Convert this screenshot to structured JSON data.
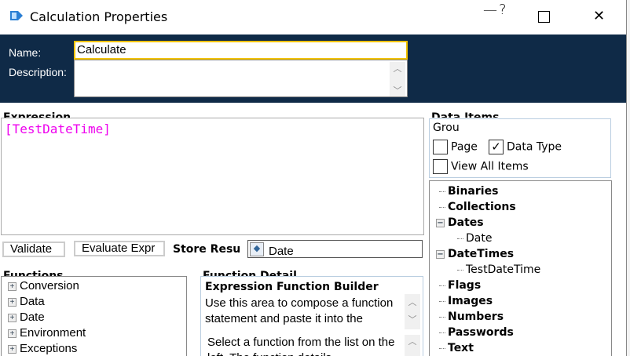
{
  "window": {
    "title": "Calculation Properties",
    "help": "?",
    "minimize": "—",
    "maximize": "☐",
    "close": "✕"
  },
  "header": {
    "name_label": "Name:",
    "name_value": "Calculate",
    "description_label": "Description:",
    "description_value": ""
  },
  "expression": {
    "label": "Expression",
    "value": "[TestDateTime]"
  },
  "toolbar": {
    "validate": "Validate",
    "evaluate": "Evaluate Expr",
    "store_label": "Store Resu",
    "store_value": "Date"
  },
  "functions": {
    "label": "Functions",
    "items": [
      "Conversion",
      "Data",
      "Date",
      "Environment",
      "Exceptions"
    ]
  },
  "function_detail": {
    "label": "Function Detail",
    "title": "Expression Function Builder",
    "text1": "Use this area to compose a function statement and paste it into the expression.",
    "text2": "Select a function from the list on the left. The function details"
  },
  "data_items": {
    "label": "Data Items",
    "group_label": "Grou",
    "page": "Page",
    "data_type": "Data Type",
    "view_all": "View All Items",
    "page_checked": false,
    "data_type_checked": true,
    "view_all_checked": false,
    "tree": [
      {
        "label": "Binaries"
      },
      {
        "label": "Collections"
      },
      {
        "label": "Dates",
        "children": [
          "Date"
        ]
      },
      {
        "label": "DateTimes",
        "children": [
          "TestDateTime"
        ]
      },
      {
        "label": "Flags"
      },
      {
        "label": "Images"
      },
      {
        "label": "Numbers"
      },
      {
        "label": "Passwords"
      },
      {
        "label": "Text"
      }
    ]
  }
}
